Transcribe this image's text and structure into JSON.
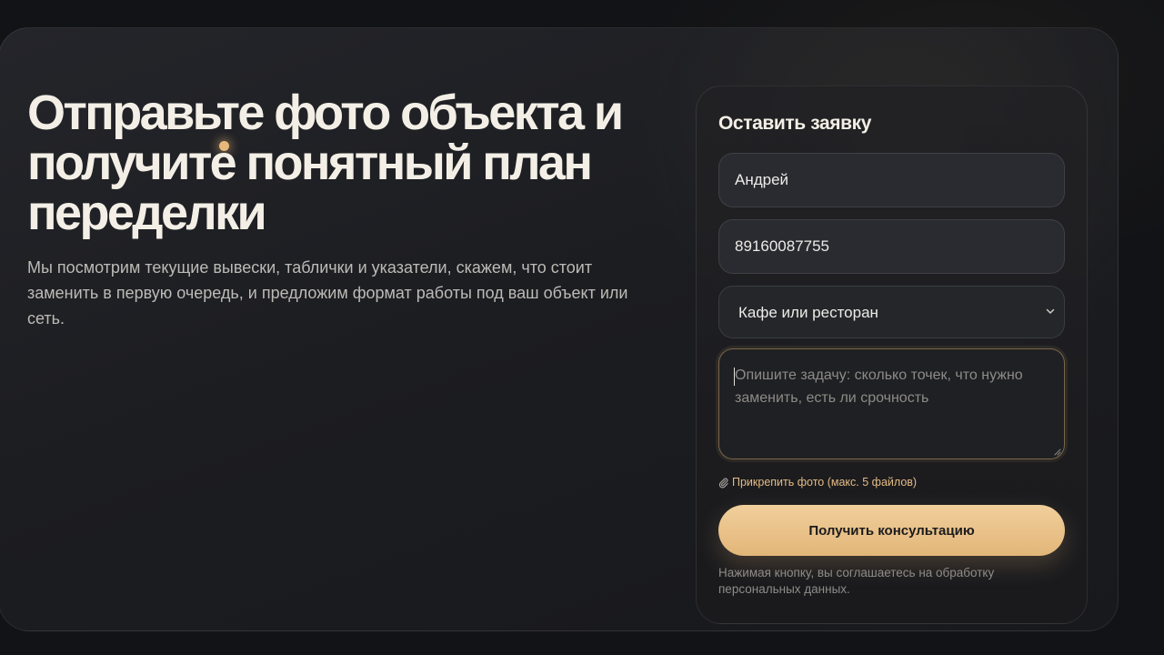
{
  "hero": {
    "title": "Отправьте фото объекта и получите понятный план переделки",
    "subtitle": "Мы посмотрим текущие вывески, таблички и указатели, скажем, что стоит заменить в первую очередь, и предложим формат работы под ваш объект или сеть."
  },
  "form": {
    "title": "Оставить заявку",
    "name_value": "Андрей",
    "phone_value": "89160087755",
    "business_type": {
      "selected": "Кафе или ресторан",
      "icon": "chevron-down-icon"
    },
    "task": {
      "value": "",
      "placeholder": "Опишите задачу: сколько точек, что нужно заменить, есть ли срочность"
    },
    "attach": {
      "icon": "paperclip-icon",
      "label": "Прикрепить фото (макс. 5 файлов)"
    },
    "submit_label": "Получить консультацию",
    "consent": "Нажимая кнопку, вы соглашаетесь на обработку персональных данных."
  },
  "colors": {
    "accent": "#e6bd82",
    "background": "#121316",
    "card": "#1f2024",
    "text": "#f3efe6"
  }
}
